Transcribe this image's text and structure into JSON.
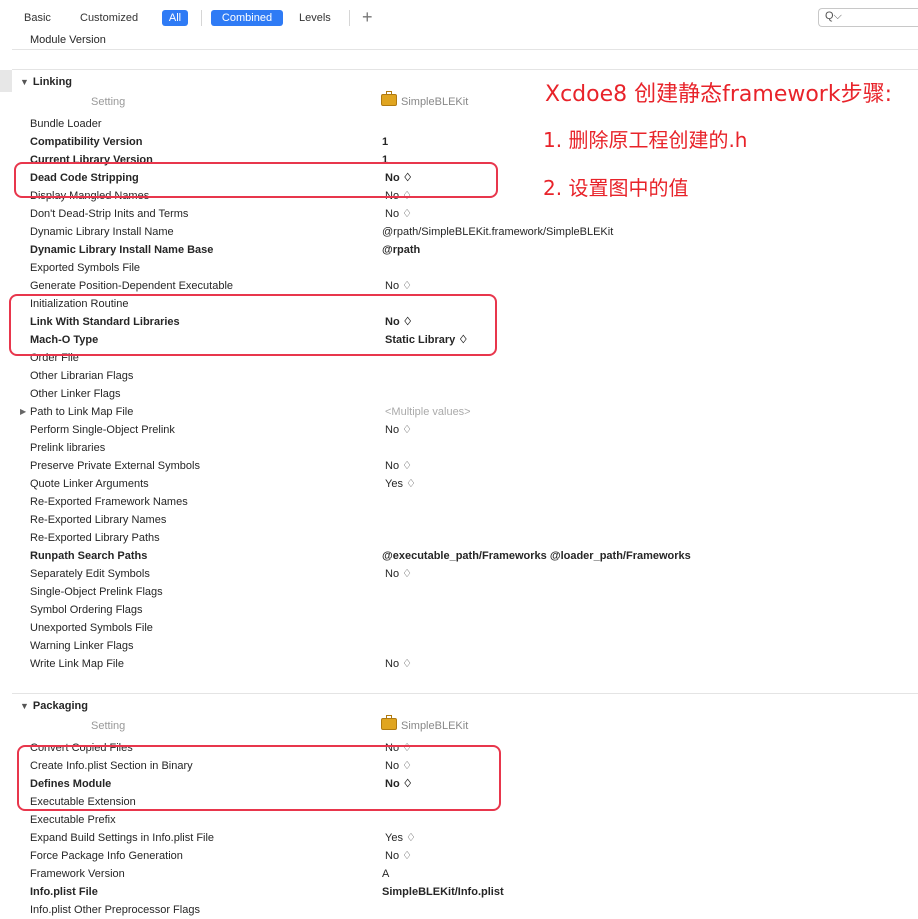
{
  "toolbar": {
    "basic": "Basic",
    "customized": "Customized",
    "all": "All",
    "combined": "Combined",
    "levels": "Levels",
    "add": "+",
    "search_icon": "Q⌵"
  },
  "top_row": "Module Version",
  "linking": {
    "title": "Linking",
    "setting_col": "Setting",
    "target": "SimpleBLEKit",
    "rows": [
      {
        "name": "Bundle Loader",
        "value": "",
        "bold": false
      },
      {
        "name": "Compatibility Version",
        "value": "1",
        "bold": true
      },
      {
        "name": "Current Library Version",
        "value": "1",
        "bold": true
      },
      {
        "name": "Dead Code Stripping",
        "value": "No ♢",
        "bold": true
      },
      {
        "name": "Display Mangled Names",
        "value": "No ♢",
        "bold": false
      },
      {
        "name": "Don't Dead-Strip Inits and Terms",
        "value": "No ♢",
        "bold": false
      },
      {
        "name": "Dynamic Library Install Name",
        "value": "@rpath/SimpleBLEKit.framework/SimpleBLEKit",
        "bold": false
      },
      {
        "name": "Dynamic Library Install Name Base",
        "value": "@rpath",
        "bold": true
      },
      {
        "name": "Exported Symbols File",
        "value": "",
        "bold": false
      },
      {
        "name": "Generate Position-Dependent Executable",
        "value": "No ♢",
        "bold": false
      },
      {
        "name": "Initialization Routine",
        "value": "",
        "bold": false
      },
      {
        "name": "Link With Standard Libraries",
        "value": "No ♢",
        "bold": true
      },
      {
        "name": "Mach-O Type",
        "value": "Static Library ♢",
        "bold": true
      },
      {
        "name": "Order File",
        "value": "",
        "bold": false
      },
      {
        "name": "Other Librarian Flags",
        "value": "",
        "bold": false
      },
      {
        "name": "Other Linker Flags",
        "value": "",
        "bold": false
      },
      {
        "name": "Path to Link Map File",
        "value": "<Multiple values>",
        "bold": false
      },
      {
        "name": "Perform Single-Object Prelink",
        "value": "No ♢",
        "bold": false
      },
      {
        "name": "Prelink libraries",
        "value": "",
        "bold": false
      },
      {
        "name": "Preserve Private External Symbols",
        "value": "No ♢",
        "bold": false
      },
      {
        "name": "Quote Linker Arguments",
        "value": "Yes ♢",
        "bold": false
      },
      {
        "name": "Re-Exported Framework Names",
        "value": "",
        "bold": false
      },
      {
        "name": "Re-Exported Library Names",
        "value": "",
        "bold": false
      },
      {
        "name": "Re-Exported Library Paths",
        "value": "",
        "bold": false
      },
      {
        "name": "Runpath Search Paths",
        "value": "@executable_path/Frameworks @loader_path/Frameworks",
        "bold": true
      },
      {
        "name": "Separately Edit Symbols",
        "value": "No ♢",
        "bold": false
      },
      {
        "name": "Single-Object Prelink Flags",
        "value": "",
        "bold": false
      },
      {
        "name": "Symbol Ordering Flags",
        "value": "",
        "bold": false
      },
      {
        "name": "Unexported Symbols File",
        "value": "",
        "bold": false
      },
      {
        "name": "Warning Linker Flags",
        "value": "",
        "bold": false
      },
      {
        "name": "Write Link Map File",
        "value": "No ♢",
        "bold": false
      }
    ]
  },
  "packaging": {
    "title": "Packaging",
    "setting_col": "Setting",
    "target": "SimpleBLEKit",
    "rows": [
      {
        "name": "Convert Copied Files",
        "value": "No ♢",
        "bold": false
      },
      {
        "name": "Create Info.plist Section in Binary",
        "value": "No ♢",
        "bold": false
      },
      {
        "name": "Defines Module",
        "value": "No ♢",
        "bold": true
      },
      {
        "name": "Executable Extension",
        "value": "",
        "bold": false
      },
      {
        "name": "Executable Prefix",
        "value": "",
        "bold": false
      },
      {
        "name": "Expand Build Settings in Info.plist File",
        "value": "Yes ♢",
        "bold": false
      },
      {
        "name": "Force Package Info Generation",
        "value": "No ♢",
        "bold": false
      },
      {
        "name": "Framework Version",
        "value": "A",
        "bold": false
      },
      {
        "name": "Info.plist File",
        "value": "SimpleBLEKit/Info.plist",
        "bold": true
      },
      {
        "name": "Info.plist Other Preprocessor Flags",
        "value": "",
        "bold": false
      }
    ]
  },
  "annotations": {
    "title": "Xcdoe8 创建静态framework步骤:",
    "step1": "1. 删除原工程创建的.h",
    "step2": "2. 设置图中的值"
  },
  "colors": {
    "accent": "#2f7bf5",
    "annotation": "#e8232a",
    "highlight_box": "#e8364c"
  }
}
